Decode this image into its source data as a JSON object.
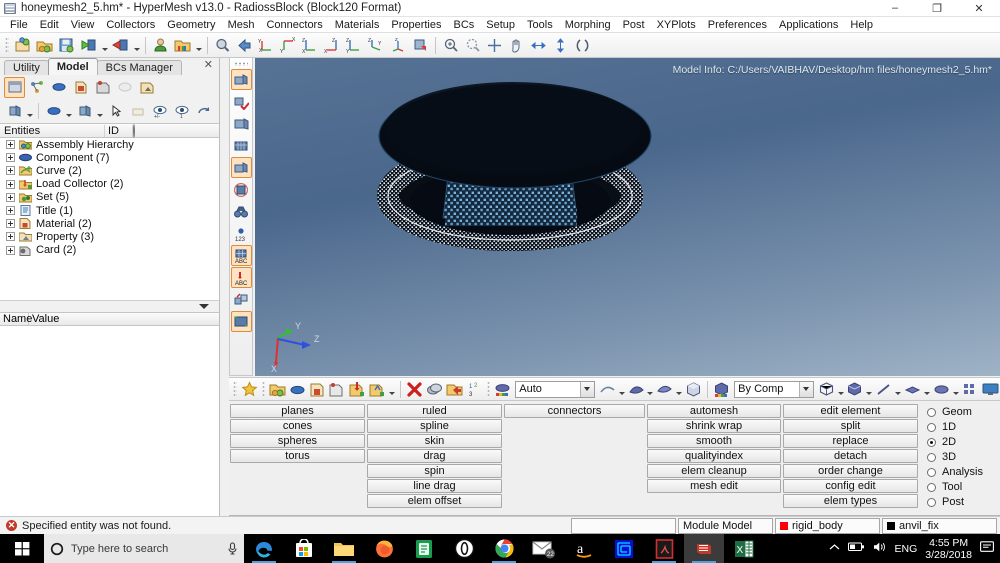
{
  "window": {
    "title": "honeymesh2_5.hm* - HyperMesh v13.0 - RadiossBlock (Block120 Format)",
    "minimize": "–",
    "maximize": "❐",
    "close": "✕"
  },
  "menubar": {
    "items": [
      {
        "label": "File"
      },
      {
        "label": "Edit"
      },
      {
        "label": "View"
      },
      {
        "label": "Collectors"
      },
      {
        "label": "Geometry"
      },
      {
        "label": "Mesh"
      },
      {
        "label": "Connectors"
      },
      {
        "label": "Materials"
      },
      {
        "label": "Properties"
      },
      {
        "label": "BCs"
      },
      {
        "label": "Setup"
      },
      {
        "label": "Tools"
      },
      {
        "label": "Morphing"
      },
      {
        "label": "Post"
      },
      {
        "label": "XYPlots"
      },
      {
        "label": "Preferences"
      },
      {
        "label": "Applications"
      },
      {
        "label": "Help"
      }
    ]
  },
  "toolbar": {
    "icons": [
      "new-model-icon",
      "open-model-icon",
      "save-model-icon",
      "import-icon",
      "export-icon",
      "user-profile-icon",
      "color-folder-icon",
      "zoom-model-icon",
      "back-arrow-icon",
      "view-xy-icon",
      "view-yx-icon",
      "view-zx-icon",
      "view-xz-icon",
      "view-yz-icon",
      "view-zy-icon",
      "view-iso-icon",
      "view-flip-icon",
      "zoom-in-icon",
      "zoom-out-icon",
      "fit-icon",
      "pan-icon",
      "arrow-horizontal-icon",
      "arrow-vertical-icon",
      "rotate-icon"
    ]
  },
  "leftpanel": {
    "tabs": [
      {
        "label": "Utility",
        "active": false
      },
      {
        "label": "Model",
        "active": true
      },
      {
        "label": "BCs Manager",
        "active": false
      }
    ],
    "close_label": "✕",
    "tools_row1": [
      "model-browser-icon",
      "entity-state-icon",
      "component-icon",
      "material-icon",
      "card-icon",
      "mask-icon",
      "property-icon"
    ],
    "tools_row2": [
      "display-icon",
      "component-display-icon",
      "element-display-icon",
      "pointer-icon",
      "note-icon",
      "show-hide-icon",
      "isolate-icon",
      "reverse-icon"
    ],
    "tree_header": {
      "entities": "Entities",
      "id": "ID",
      "color": "color-wheel-icon"
    },
    "tree_items": [
      {
        "label": "Assembly Hierarchy",
        "icon": "assembly-icon",
        "color": "#d89a3a"
      },
      {
        "label": "Component (7)",
        "icon": "component-icon",
        "color": "#3a63b0"
      },
      {
        "label": "Curve (2)",
        "icon": "curve-icon",
        "color": "#49a045"
      },
      {
        "label": "Load Collector (2)",
        "icon": "load-collector-icon",
        "color": "#c94a2a"
      },
      {
        "label": "Set (5)",
        "icon": "set-icon",
        "color": "#3e9c3e"
      },
      {
        "label": "Title (1)",
        "icon": "title-icon",
        "color": "#3f7fbf"
      },
      {
        "label": "Material (2)",
        "icon": "material-icon",
        "color": "#c94a2a"
      },
      {
        "label": "Property (3)",
        "icon": "property-icon",
        "color": "#7a7a8c"
      },
      {
        "label": "Card (2)",
        "icon": "card-icon",
        "color": "#6b6b6b"
      }
    ],
    "nv_header": {
      "name": "Name",
      "value": "Value"
    }
  },
  "vertical_strip": {
    "icons": [
      "mesh-lines-icon",
      "mesh-check-icon",
      "mesh-plain-icon",
      "mesh-dense-icon",
      "mesh-box-icon",
      "mesh-circle-icon",
      "binoculars-icon",
      "numbering-icon",
      "abc-table-icon",
      "abc-label-icon",
      "mesh-move-icon",
      "view-frame-icon"
    ]
  },
  "viewport": {
    "model_info": "Model Info: C:/Users/VAIBHAV/Desktop/hm files/honeymesh2_5.hm*",
    "axis_labels": {
      "x": "X",
      "y": "Y",
      "z": "Z"
    },
    "model_description": "honeycomb cylinder mesh between two rings"
  },
  "bottombar": {
    "icons_left": [
      "favorite-star-icon",
      "component-collector-icon",
      "component-icon",
      "material-collector-icon",
      "card-collector-icon",
      "load-collector-icon",
      "system-collector-icon",
      "delete-icon",
      "organize-icon",
      "color-folder-icon",
      "renumber-icon"
    ],
    "mode_combo": {
      "label": "Auto",
      "icon": "color-mode-icon"
    },
    "shade_icons": [
      "wireframe-shade-icon",
      "smooth-shade-icon",
      "solid-shade-icon"
    ],
    "by_comp_combo": {
      "label": "By Comp",
      "icon": "color-by-icon"
    },
    "right_icons": [
      "mesh-wire-icon",
      "mesh-solid-icon",
      "line-display-icon",
      "surface-display-icon",
      "solid-display-icon",
      "element-grid-icon",
      "screen-icon"
    ]
  },
  "panelgrid": {
    "columns": [
      {
        "buttons": [
          "planes",
          "cones",
          "spheres",
          "torus"
        ]
      },
      {
        "buttons": [
          "ruled",
          "spline",
          "skin",
          "drag",
          "spin",
          "line drag",
          "elem offset"
        ]
      },
      {
        "buttons": [
          "connectors"
        ]
      },
      {
        "buttons": [
          "automesh",
          "shrink wrap",
          "smooth",
          "qualityindex",
          "elem cleanup",
          "mesh edit"
        ]
      },
      {
        "buttons": [
          "edit element",
          "split",
          "replace",
          "detach",
          "order change",
          "config edit",
          "elem types"
        ]
      }
    ],
    "radios": [
      {
        "label": "Geom",
        "selected": false
      },
      {
        "label": "1D",
        "selected": false
      },
      {
        "label": "2D",
        "selected": true
      },
      {
        "label": "3D",
        "selected": false
      },
      {
        "label": "Analysis",
        "selected": false
      },
      {
        "label": "Tool",
        "selected": false
      },
      {
        "label": "Post",
        "selected": false
      }
    ]
  },
  "statusbar": {
    "message": "Specified entity was not found.",
    "error_icon": "✕",
    "input_value": "",
    "module": "Module Model",
    "entity1": {
      "label": "rigid_body",
      "color": "#ff0000"
    },
    "entity2": {
      "label": "anvil_fix",
      "color": "#000000"
    }
  },
  "taskbar": {
    "start_icon": "windows-start-icon",
    "search_placeholder": "Type here to search",
    "search_icon": "search-circle-icon",
    "mic_icon": "microphone-icon",
    "apps": [
      {
        "name": "edge-icon",
        "running": true,
        "active": false
      },
      {
        "name": "store-icon",
        "running": false,
        "active": false
      },
      {
        "name": "file-explorer-icon",
        "running": true,
        "active": false
      },
      {
        "name": "firefox-icon",
        "running": false,
        "active": false
      },
      {
        "name": "notes-icon",
        "running": false,
        "active": false
      },
      {
        "name": "opera-icon",
        "running": false,
        "active": false
      },
      {
        "name": "chrome-icon",
        "running": true,
        "active": false
      },
      {
        "name": "mail-icon",
        "running": false,
        "active": false,
        "badge": "22"
      },
      {
        "name": "amazon-icon",
        "running": false,
        "active": false
      },
      {
        "name": "blue-logo-icon",
        "running": false,
        "active": false
      },
      {
        "name": "acrobat-reader-icon",
        "running": true,
        "active": false
      },
      {
        "name": "hypermesh-icon",
        "running": true,
        "active": true
      },
      {
        "name": "excel-icon",
        "running": false,
        "active": false
      }
    ],
    "tray": {
      "chevron_icon": "show-hidden-icons-icon",
      "battery_icon": "battery-icon",
      "volume_icon": "volume-icon",
      "language": "ENG",
      "time": "4:55 PM",
      "date": "3/28/2018",
      "action_center_icon": "notifications-icon"
    }
  }
}
